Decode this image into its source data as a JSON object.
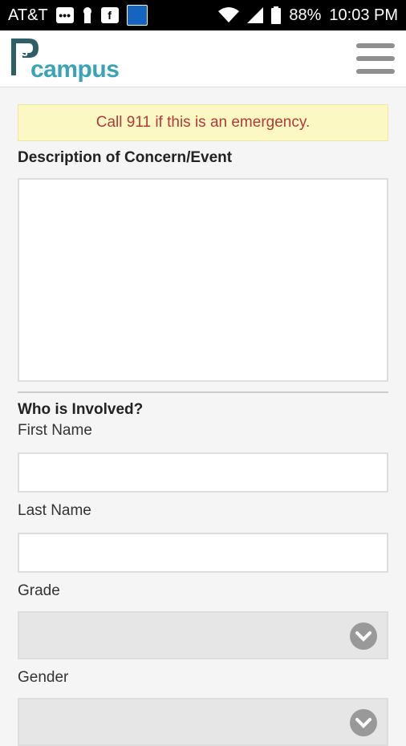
{
  "status_bar": {
    "carrier": "AT&T",
    "battery": "88%",
    "time": "10:03 PM"
  },
  "header": {
    "logo_text": "campus",
    "logo_mark": "P3"
  },
  "form": {
    "alert_text": "Call 911 if this is an emergency.",
    "description_label": "Description of Concern/Event",
    "description_value": "",
    "involved_title": "Who is Involved?",
    "first_name_label": "First Name",
    "first_name_value": "",
    "last_name_label": "Last Name",
    "last_name_value": "",
    "grade_label": "Grade",
    "grade_value": "",
    "gender_label": "Gender",
    "gender_value": ""
  },
  "colors": {
    "alert_bg": "#fcf8c4",
    "alert_text": "#b23a3a",
    "brand": "#3aa3b6"
  }
}
